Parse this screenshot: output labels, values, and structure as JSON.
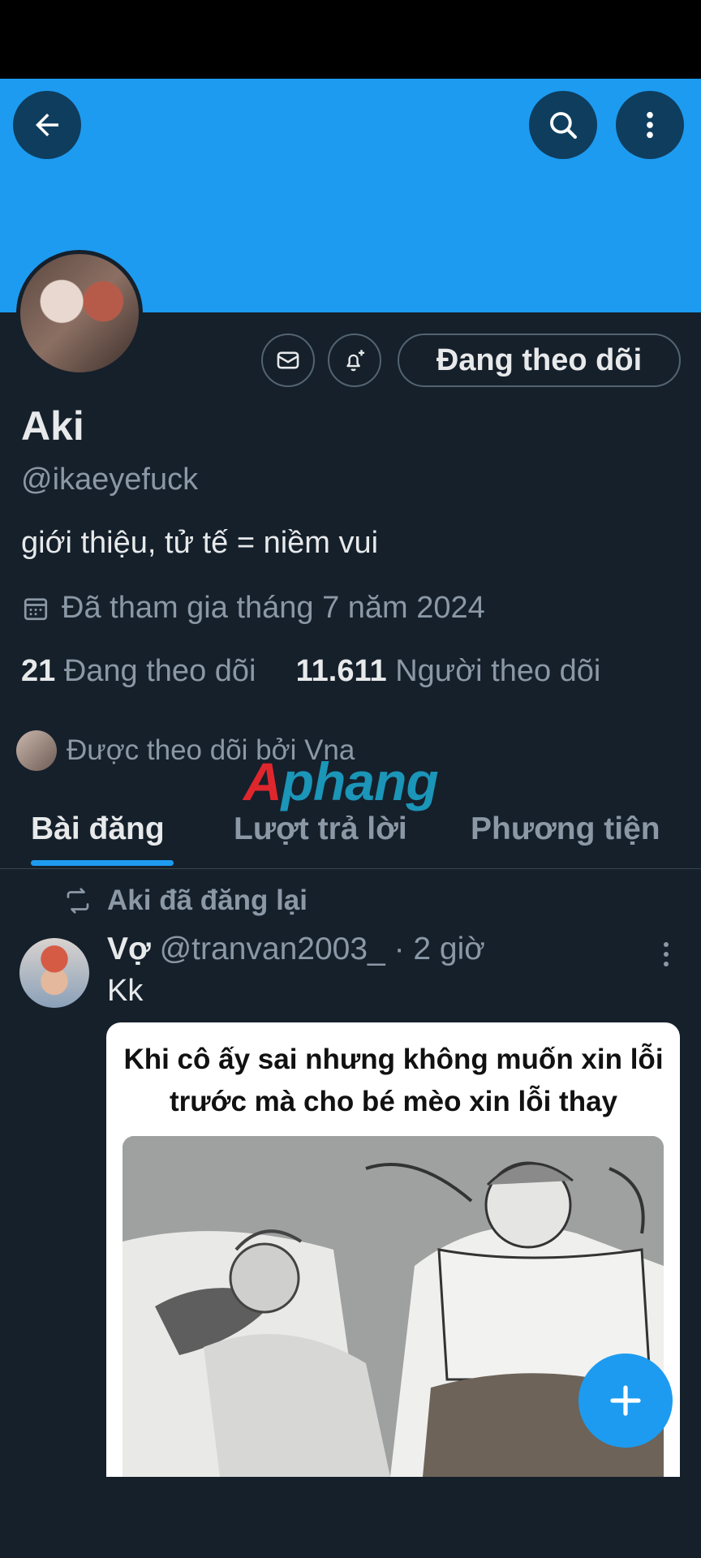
{
  "header": {
    "back_icon": "arrow-left-icon",
    "search_icon": "search-icon",
    "more_icon": "more-vertical-icon",
    "banner_color": "#1d9bf0"
  },
  "profile": {
    "name": "Aki",
    "handle": "@ikaeyefuck",
    "bio": "giới thiệu, tử tế = niềm vui",
    "joined": "Đã tham gia tháng 7 năm 2024",
    "following_count": "21",
    "following_label": "Đang theo dõi",
    "followers_count": "11.611",
    "followers_label": "Người theo dõi",
    "followed_by": "Được theo dõi bởi Vna",
    "follow_button_label": "Đang theo dõi"
  },
  "watermark": {
    "part1": "A",
    "part2": "phang"
  },
  "tabs": [
    {
      "label": "Bài đăng",
      "active": true
    },
    {
      "label": "Lượt trả lời",
      "active": false
    },
    {
      "label": "Phương tiện",
      "active": false
    }
  ],
  "post": {
    "repost_label": "Aki đã đăng lại",
    "author_name": "Vợ",
    "author_handle": "@tranvan2003_",
    "time": "· 2 giờ",
    "text": "Kk",
    "media_caption": "Khi cô ấy sai nhưng không muốn xin lỗi trước mà cho bé mèo xin lỗi thay"
  },
  "colors": {
    "accent": "#1d9bf0",
    "background": "#15202b",
    "muted_text": "#8b98a5"
  }
}
